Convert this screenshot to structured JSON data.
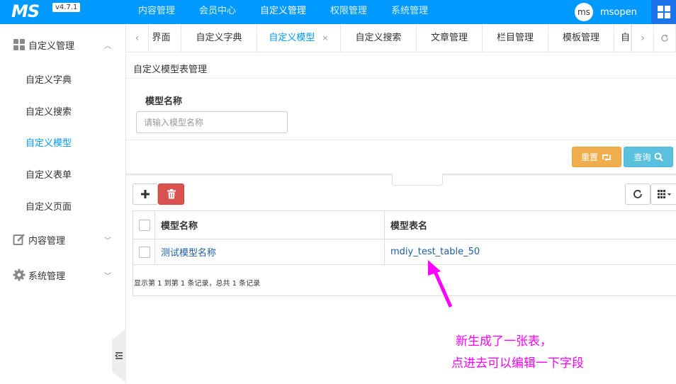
{
  "header": {
    "logo": "MS",
    "version": "v4.7.1",
    "nav": [
      "内容管理",
      "会员中心",
      "自定义管理",
      "权限管理",
      "系统管理"
    ],
    "active_nav": 2,
    "avatar_text": "ms",
    "username": "msopen",
    "bg_color": "#0099ff"
  },
  "sidebar": {
    "group_custom": "自定义管理",
    "sub_items": [
      "自定义字典",
      "自定义搜索",
      "自定义模型",
      "自定义表单",
      "自定义页面"
    ],
    "active_sub": 2,
    "group_content": "内容管理",
    "group_system": "系统管理"
  },
  "tabs": {
    "items": [
      "界面",
      "自定义字典",
      "自定义模型",
      "自定义搜索",
      "文章管理",
      "栏目管理",
      "模板管理",
      "自"
    ],
    "active": 2,
    "close_glyph": "×"
  },
  "panel": {
    "title": "自定义模型表管理"
  },
  "search": {
    "label": "模型名称",
    "placeholder": "请输入模型名称",
    "reset_label": "重置",
    "query_label": "查询"
  },
  "table": {
    "columns": [
      "模型名称",
      "模型表名"
    ],
    "rows": [
      {
        "name": "测试模型名称",
        "table_name": "mdiy_test_table_50"
      }
    ],
    "pager_info": "显示第 1 到第 1 条记录，总共 1 条记录"
  },
  "annotation": {
    "line1": "新生成了一张表，",
    "line2": "点进去可以编辑一下字段",
    "color": "#ff00ff"
  }
}
